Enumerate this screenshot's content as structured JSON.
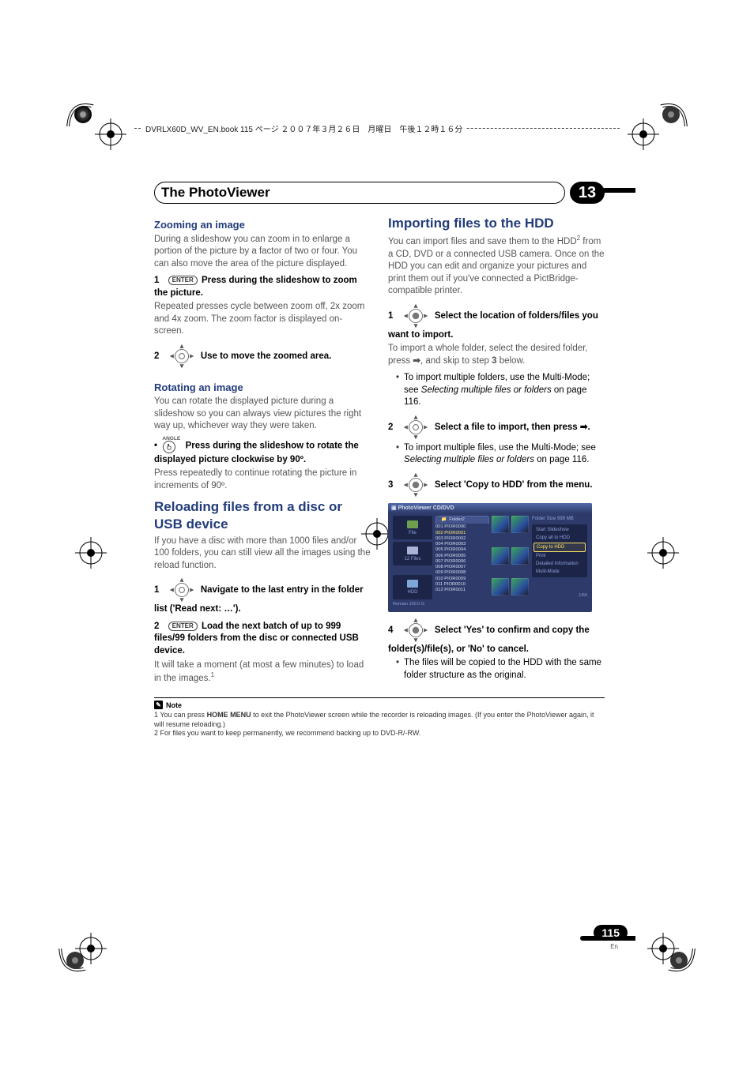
{
  "header_runner": "DVRLX60D_WV_EN.book 115 ページ ２００７年３月２６日　月曜日　午後１２時１６分",
  "chapter_title": "The PhotoViewer",
  "chapter_num": "13",
  "page_number": "115",
  "page_lang": "En",
  "left": {
    "h_zoom": "Zooming an image",
    "zoom_intro": "During a slideshow you can zoom in to enlarge a portion of the picture by a factor of two or four. You can also move the area of the picture displayed.",
    "zoom_step1_num": "1",
    "zoom_step1_btn": "ENTER",
    "zoom_step1_text": "Press during the slideshow to zoom the picture.",
    "zoom_step1_body": "Repeated presses cycle between zoom off, 2x zoom and 4x zoom. The zoom factor is displayed on-screen.",
    "zoom_step2_num": "2",
    "zoom_step2_text": "Use to move the zoomed area.",
    "h_rotate": "Rotating an image",
    "rotate_intro": "You can rotate the displayed picture during a slideshow so you can always view pictures the right way up, whichever way they were taken.",
    "rotate_btn_top": "ANGLE",
    "rotate_step_text": "Press during the slideshow to rotate the displayed picture clockwise by 90º.",
    "rotate_body": "Press repeatedly to continue rotating the picture in increments of 90º.",
    "h_reload": "Reloading files from a disc or USB device",
    "reload_intro": "If you have a disc with more than 1000 files and/or 100 folders, you can still view all the images using the reload function.",
    "reload_step1_num": "1",
    "reload_step1_text": "Navigate to the last entry in the folder list ('Read next: …').",
    "reload_step2_num": "2",
    "reload_step2_btn": "ENTER",
    "reload_step2_text": "Load the next batch of up to 999 files/99 folders from the disc or connected USB device.",
    "reload_step2_body_a": "It will take a moment (at most a few minutes) to load in the images.",
    "reload_step2_sup": "1"
  },
  "right": {
    "h_import": "Importing files to the HDD",
    "import_intro_a": "You can import files and save them to the HDD",
    "import_sup": "2",
    "import_intro_b": " from a CD, DVD or a connected USB camera. Once on the HDD you can edit and organize your pictures and print them out if you've connected a PictBridge-compatible printer.",
    "imp_step1_num": "1",
    "imp_step1_text": "Select the location of folders/files you want to import.",
    "imp_step1_body": "To import a whole folder, select the desired folder, press ",
    "imp_step1_body2": ", and skip to step ",
    "imp_step1_bold3": "3",
    "imp_step1_body3": " below.",
    "imp_step1_bullet": "To import multiple folders, use the Multi-Mode; see ",
    "imp_step1_bullet_i": "Selecting multiple files or folders",
    "imp_step1_bullet_end": " on page 116.",
    "imp_step2_num": "2",
    "imp_step2_text": "Select a file to import, then press ",
    "imp_step2_text_end": ".",
    "imp_step2_bullet": "To import multiple files, use the Multi-Mode; see ",
    "imp_step2_bullet_i": "Selecting multiple files or folders",
    "imp_step2_bullet_end": " on page 116.",
    "imp_step3_num": "3",
    "imp_step3_text": "Select 'Copy to HDD' from the menu.",
    "imp_step4_num": "4",
    "imp_step4_text": "Select 'Yes' to confirm and copy the folder(s)/file(s), or 'No' to cancel.",
    "imp_step4_bullet": "The files will be copied to the HDD with the same folder structure as the original."
  },
  "screenshot": {
    "title_bar": "PhotoViewer  CD/DVD",
    "folder_tab": "Folder2",
    "folder_size": "Folder Size 999 MB",
    "left_file": "File",
    "left_files_count": "12 Files",
    "left_hdd": "HDD",
    "remain": "Remain 100.0 G",
    "list": [
      "001 PIOR0000",
      "002 PIOR0001",
      "003 PIOR0002",
      "004 PIOR0003",
      "005 PIOR0004",
      "006 PIOR0005",
      "007 PIOR0006",
      "008 PIOR0007",
      "009 PIOR0008",
      "010 PIOR0009",
      "011 PIOR0010",
      "012 PIOR0011"
    ],
    "menu": [
      "Start Slideshow",
      "Copy all to HDD",
      "Copy to HDD",
      "Print",
      "Detailed Information",
      "Multi-Mode"
    ],
    "menu_highlight_index": 2,
    "pager": "1/64"
  },
  "notes": {
    "heading": "Note",
    "n1_a": "1 You can press ",
    "n1_b": "HOME MENU",
    "n1_c": " to exit the PhotoViewer screen while the recorder is reloading images. (If you enter the PhotoViewer again, it will resume reloading.)",
    "n2": "2 For files you want to keep permanently, we recommend backing up to DVD-R/-RW."
  }
}
